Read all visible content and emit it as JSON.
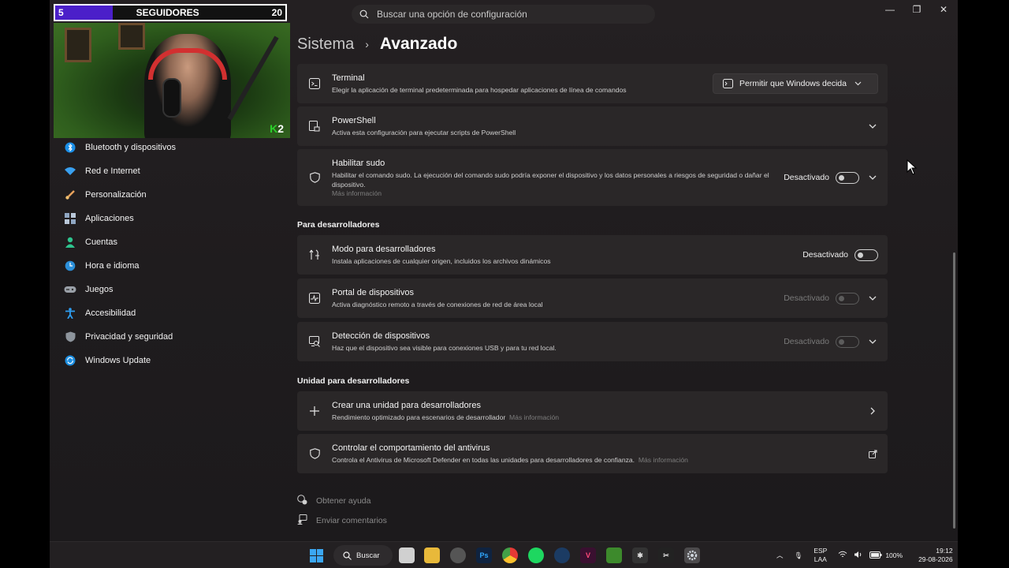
{
  "overlay": {
    "current": "5",
    "label": "SEGUIDORES",
    "goal": "20",
    "progress": 0.25,
    "cam_logo": "2"
  },
  "search": {
    "placeholder": "Buscar una opción de configuración"
  },
  "window_controls": {
    "minimize": "—",
    "maximize": "❐",
    "close": "✕"
  },
  "nav": [
    {
      "label": "Bluetooth y dispositivos",
      "icon": "bluetooth-icon"
    },
    {
      "label": "Red e Internet",
      "icon": "wifi-icon"
    },
    {
      "label": "Personalización",
      "icon": "brush-icon"
    },
    {
      "label": "Aplicaciones",
      "icon": "apps-icon"
    },
    {
      "label": "Cuentas",
      "icon": "account-icon"
    },
    {
      "label": "Hora e idioma",
      "icon": "globe-clock-icon"
    },
    {
      "label": "Juegos",
      "icon": "gamepad-icon"
    },
    {
      "label": "Accesibilidad",
      "icon": "accessibility-icon"
    },
    {
      "label": "Privacidad y seguridad",
      "icon": "shield-icon"
    },
    {
      "label": "Windows Update",
      "icon": "update-icon"
    }
  ],
  "breadcrumb": {
    "parent": "Sistema",
    "current": "Avanzado"
  },
  "terminal": {
    "title": "Terminal",
    "desc": "Elegir la aplicación de terminal predeterminada para hospedar aplicaciones de línea de comandos",
    "value": "Permitir que Windows decida"
  },
  "powershell": {
    "title": "PowerShell",
    "desc": "Activa esta configuración para ejecutar scripts de PowerShell"
  },
  "sudo": {
    "title": "Habilitar sudo",
    "desc": "Habilitar el comando sudo. La ejecución del comando sudo podría exponer el dispositivo y los datos personales a riesgos de seguridad o dañar el dispositivo.",
    "more": "Más información",
    "state": "Desactivado"
  },
  "dev_section": "Para desarrolladores",
  "devmode": {
    "title": "Modo para desarrolladores",
    "desc": "Instala aplicaciones de cualquier origen, incluidos los archivos dinámicos",
    "state": "Desactivado"
  },
  "portal": {
    "title": "Portal de dispositivos",
    "desc": "Activa diagnóstico remoto a través de conexiones de red de área local",
    "state": "Desactivado"
  },
  "discovery": {
    "title": "Detección de dispositivos",
    "desc": "Haz que el dispositivo sea visible para conexiones USB y para tu red local.",
    "state": "Desactivado"
  },
  "drive_section": "Unidad para desarrolladores",
  "create_drive": {
    "title": "Crear una unidad para desarrolladores",
    "desc": "Rendimiento optimizado para escenarios de desarrollador",
    "more": "Más información"
  },
  "antivirus": {
    "title": "Controlar el comportamiento del antivirus",
    "desc": "Controla el Antivirus de Microsoft Defender en todas las unidades para desarrolladores de confianza.",
    "more": "Más información"
  },
  "footer": {
    "help": "Obtener ayuda",
    "feedback": "Enviar comentarios"
  },
  "taskbar": {
    "search": "Buscar",
    "lang_top": "ESP",
    "lang_bottom": "LAA",
    "battery": "100%",
    "time": "19:12",
    "date": "29-08-2026",
    "apps": [
      "start-icon",
      "file-explorer-icon",
      "chrome-alt-icon",
      "photoshop-icon",
      "chrome-icon",
      "spotify-icon",
      "steam-icon",
      "vegas-icon",
      "minecraft-icon",
      "game-icon",
      "capcut-icon",
      "settings-icon"
    ]
  },
  "colors": {
    "accent": "#4b1fc9",
    "background": "#1f1c1e",
    "card": "#2a2728"
  }
}
